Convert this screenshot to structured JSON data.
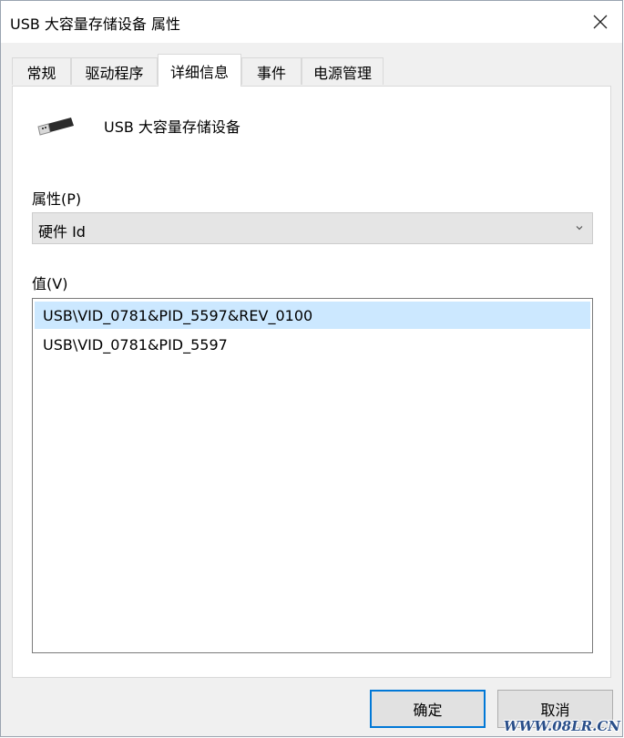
{
  "window": {
    "title": "USB 大容量存储设备 属性",
    "close_icon": "close-icon"
  },
  "tabs": [
    {
      "label": "常规",
      "active": false
    },
    {
      "label": "驱动程序",
      "active": false
    },
    {
      "label": "详细信息",
      "active": true
    },
    {
      "label": "事件",
      "active": false
    },
    {
      "label": "电源管理",
      "active": false
    }
  ],
  "device": {
    "name": "USB 大容量存储设备",
    "icon": "usb-drive-icon"
  },
  "property": {
    "label": "属性(P)",
    "selected": "硬件 Id"
  },
  "values": {
    "label": "值(V)",
    "items": [
      {
        "text": "USB\\VID_0781&PID_5597&REV_0100",
        "selected": true
      },
      {
        "text": "USB\\VID_0781&PID_5597",
        "selected": false
      }
    ]
  },
  "buttons": {
    "ok": "确定",
    "cancel": "取消"
  },
  "watermark": "WWW.08LR.CN",
  "colors": {
    "selection": "#cce8ff",
    "primary_border": "#0078d7"
  }
}
